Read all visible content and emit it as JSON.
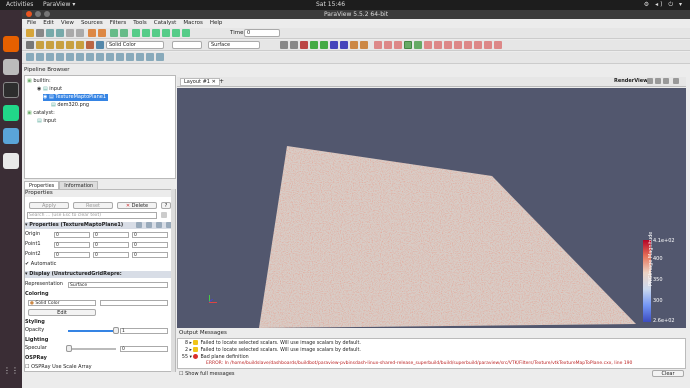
{
  "system": {
    "activities": "Activities",
    "app": "ParaView ▾",
    "clock": "Sat 15:46",
    "tray": "⚙ ◂) ⏻ ▾"
  },
  "window": {
    "title": "ParaView 5.5.2 64-bit"
  },
  "menu": [
    "File",
    "Edit",
    "View",
    "Sources",
    "Filters",
    "Tools",
    "Catalyst",
    "Macros",
    "Help"
  ],
  "toolbar": {
    "time_label": "Time:",
    "time_value": "0",
    "color_combo": "Solid Color",
    "repr_combo": "Surface"
  },
  "pipeline": {
    "title": "Pipeline Browser",
    "items": [
      {
        "label": "builtin:",
        "indent": 0
      },
      {
        "label": "input",
        "indent": 1
      },
      {
        "label": "TextureMaptoPlane1",
        "indent": 2,
        "selected": true
      },
      {
        "label": "dem320.png",
        "indent": 2
      },
      {
        "label": "catalyst:",
        "indent": 0
      },
      {
        "label": "input",
        "indent": 1
      }
    ]
  },
  "tabs": {
    "properties": "Properties",
    "information": "Information"
  },
  "props": {
    "header": "Properties",
    "apply": "Apply",
    "reset": "Reset",
    "delete": "Delete",
    "search_placeholder": "Search ... (use Esc to clear text)",
    "section1": "Properties (TextureMaptoPlane1)",
    "origin_label": "Origin",
    "point1_label": "Point1",
    "point2_label": "Point2",
    "origin": [
      "0",
      "0",
      "0"
    ],
    "point1": [
      "0",
      "0",
      "0"
    ],
    "point2": [
      "0",
      "0",
      "0"
    ],
    "automatic": "Automatic",
    "section2": "Display (UnstructuredGridRepre:",
    "repr_label": "Representation",
    "repr_value": "Surface",
    "coloring": "Coloring",
    "color_value": "Solid Color",
    "edit": "Edit",
    "styling": "Styling",
    "opacity_label": "Opacity",
    "opacity_value": "1",
    "lighting": "Lighting",
    "specular_label": "Specular",
    "specular_value": "0",
    "ospray": "OSPRay",
    "ospray_scale": "OSPRay Use Scale Array"
  },
  "view": {
    "layout_tab": "Layout #1",
    "render_label": "RenderView2"
  },
  "colorbar": {
    "max": "4.1e+02",
    "min": "2.6e+02",
    "title": "PNGImage Magnitude",
    "ticks": [
      "400",
      "350",
      "300"
    ]
  },
  "output": {
    "title": "Output Messages",
    "rows": [
      {
        "count": "8",
        "type": "warn",
        "text": "Failed to locate selected scalars. Will use image scalars by default."
      },
      {
        "count": "2",
        "type": "warn",
        "text": "Failed to locate selected scalars. Will use image scalars by default."
      },
      {
        "count": "55",
        "type": "err",
        "text": "Bad plane definition"
      },
      {
        "count": "",
        "type": "none",
        "text": "ERROR: In /home/buildslave/dashboards/buildbot/paraview-pvbinsdash-linux-shared-release_superbuild/build/superbuild/paraview/src/VTK/Filters/Texture/vtkTextureMapToPlane.cxx, line 190"
      }
    ],
    "show_full": "Show full messages",
    "clear": "Clear"
  },
  "colors": {
    "accent": "#3584e4",
    "view_bg": "#52576e",
    "dock_bg": "#3a2d35",
    "error": "#d9302c"
  }
}
